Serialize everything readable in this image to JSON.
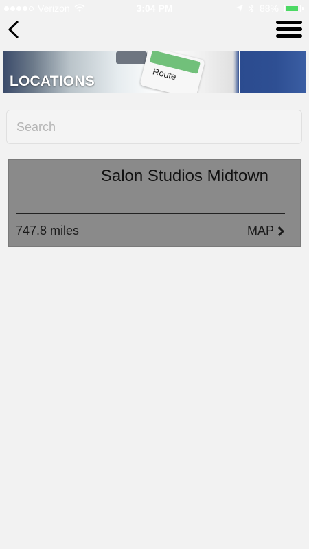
{
  "status_bar": {
    "carrier": "Verizon",
    "time": "3:04 PM",
    "battery": "88%"
  },
  "icons": {
    "back": "back-chevron-icon",
    "menu": "hamburger-menu-icon",
    "wifi": "wifi-icon",
    "location": "location-arrow-icon",
    "bluetooth": "bluetooth-icon",
    "battery": "battery-icon",
    "map_chevron": "chevron-right-icon"
  },
  "banner": {
    "title": "LOCATIONS",
    "image_text": "Route"
  },
  "search": {
    "placeholder": "Search",
    "value": ""
  },
  "locations": [
    {
      "name": "Salon Studios Midtown",
      "distance": "747.8 miles",
      "map_label": "MAP"
    }
  ],
  "colors": {
    "background": "#f2f2f2",
    "card": "#8a8a8a",
    "battery_fill": "#4cd964"
  }
}
